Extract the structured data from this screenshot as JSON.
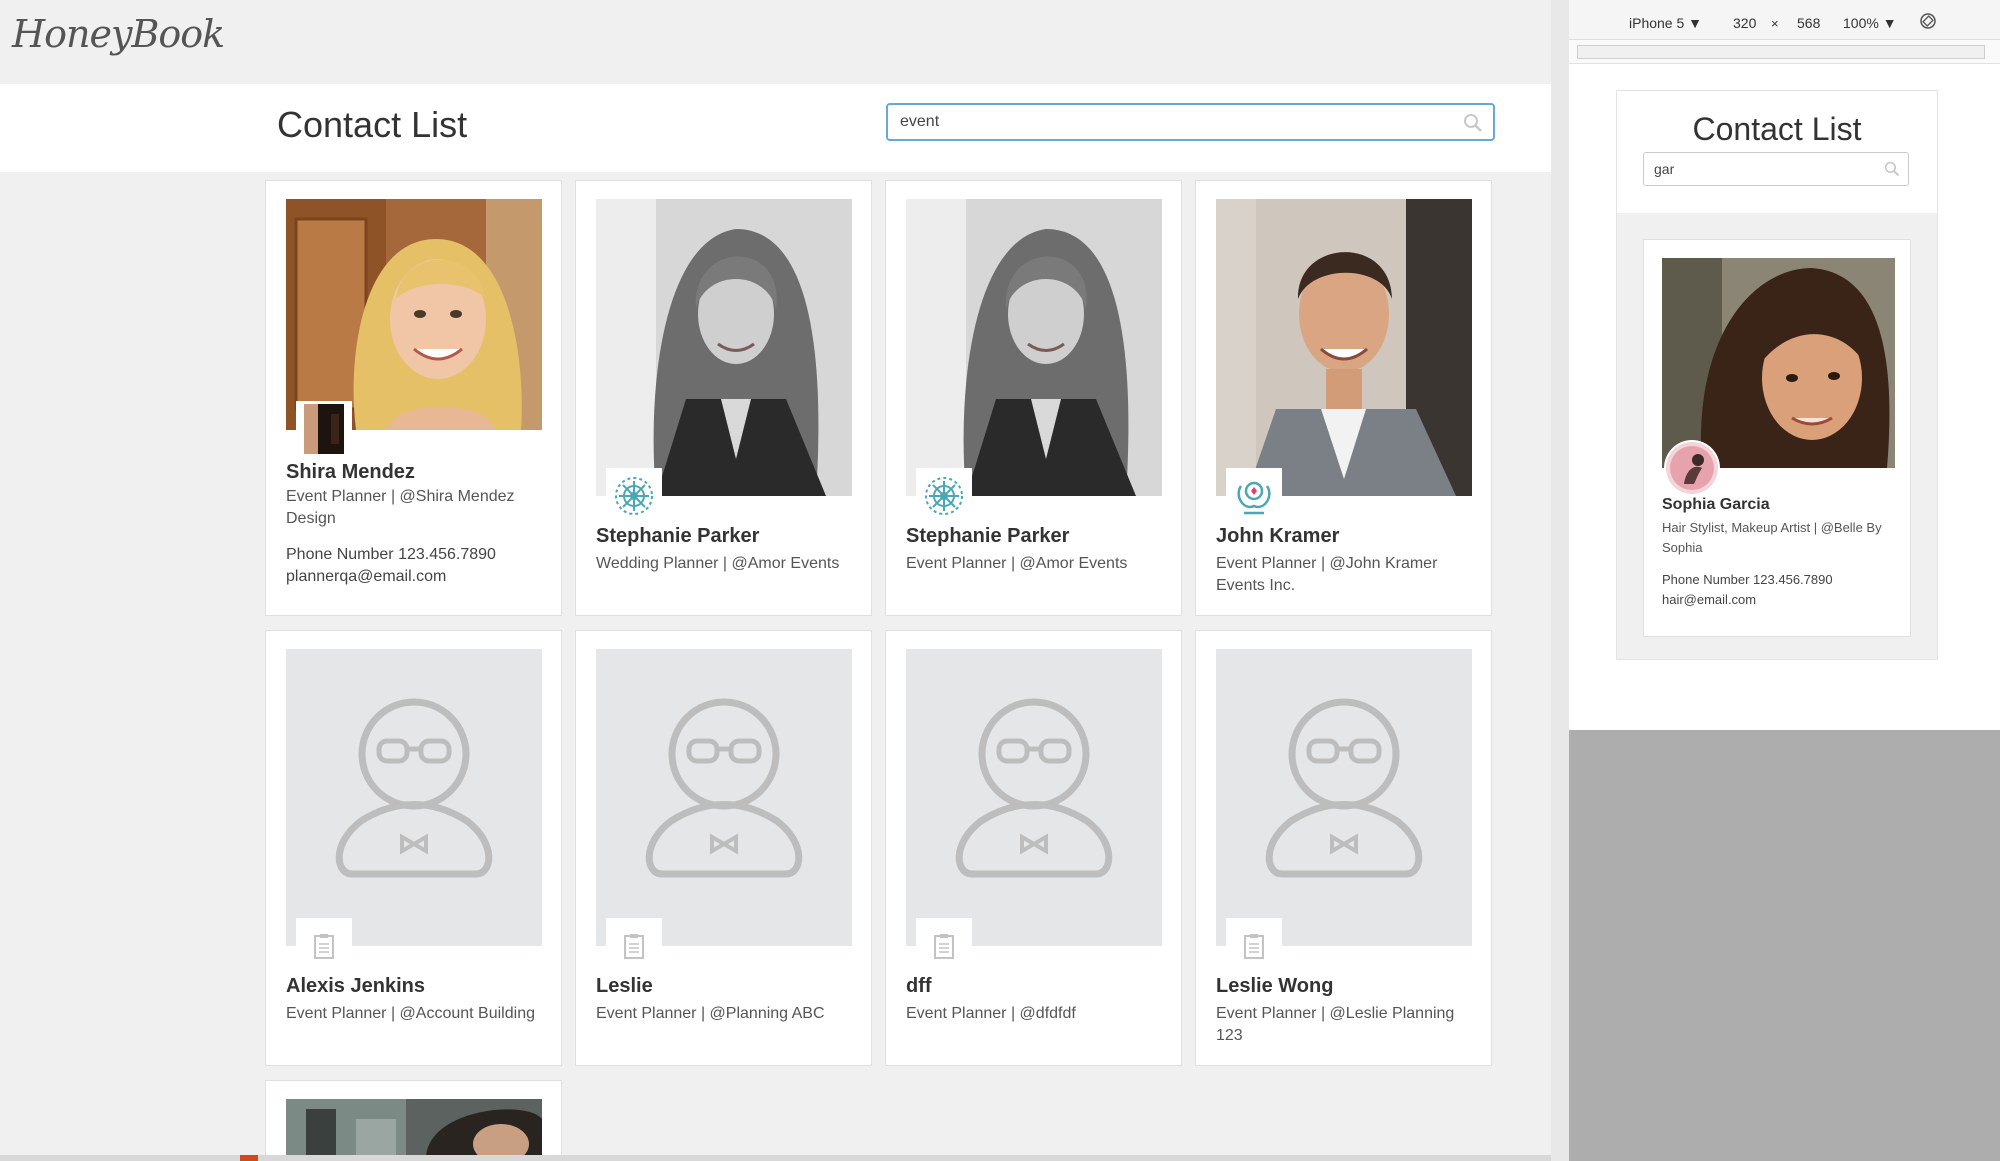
{
  "app": {
    "logo": "HoneyBook",
    "title": "Contact List",
    "search": {
      "value": "event",
      "placeholder": ""
    }
  },
  "cards": [
    {
      "name": "Shira Mendez",
      "role": "Event Planner | @Shira Mendez Design",
      "phone": "Phone Number 123.456.7890",
      "email": "plannerqa@email.com"
    },
    {
      "name": "Stephanie Parker",
      "role": "Wedding Planner | @Amor Events"
    },
    {
      "name": "Stephanie Parker",
      "role": "Event Planner | @Amor Events"
    },
    {
      "name": "John Kramer",
      "role": "Event Planner | @John Kramer Events Inc."
    },
    {
      "name": "Alexis Jenkins",
      "role": "Event Planner | @Account Building"
    },
    {
      "name": "Leslie",
      "role": "Event Planner | @Planning ABC"
    },
    {
      "name": "dff",
      "role": "Event Planner | @dfdfdf"
    },
    {
      "name": "Leslie Wong",
      "role": "Event Planner | @Leslie Planning 123"
    }
  ],
  "device": {
    "model": "iPhone 5",
    "width": "320",
    "times": "×",
    "height": "568",
    "zoom": "100%",
    "mobile": {
      "title": "Contact List",
      "search_value": "gar",
      "card": {
        "name": "Sophia Garcia",
        "role": "Hair Stylist, Makeup Artist | @Belle By Sophia",
        "phone": "Phone Number 123.456.7890",
        "email": "hair@email.com"
      }
    }
  },
  "colors": {
    "accent_border": "#66a8d8",
    "badge_teal": "#4aa7b5",
    "placeholder_bg": "#e5e6e7",
    "placeholder_figure": "#bdbdbd"
  }
}
